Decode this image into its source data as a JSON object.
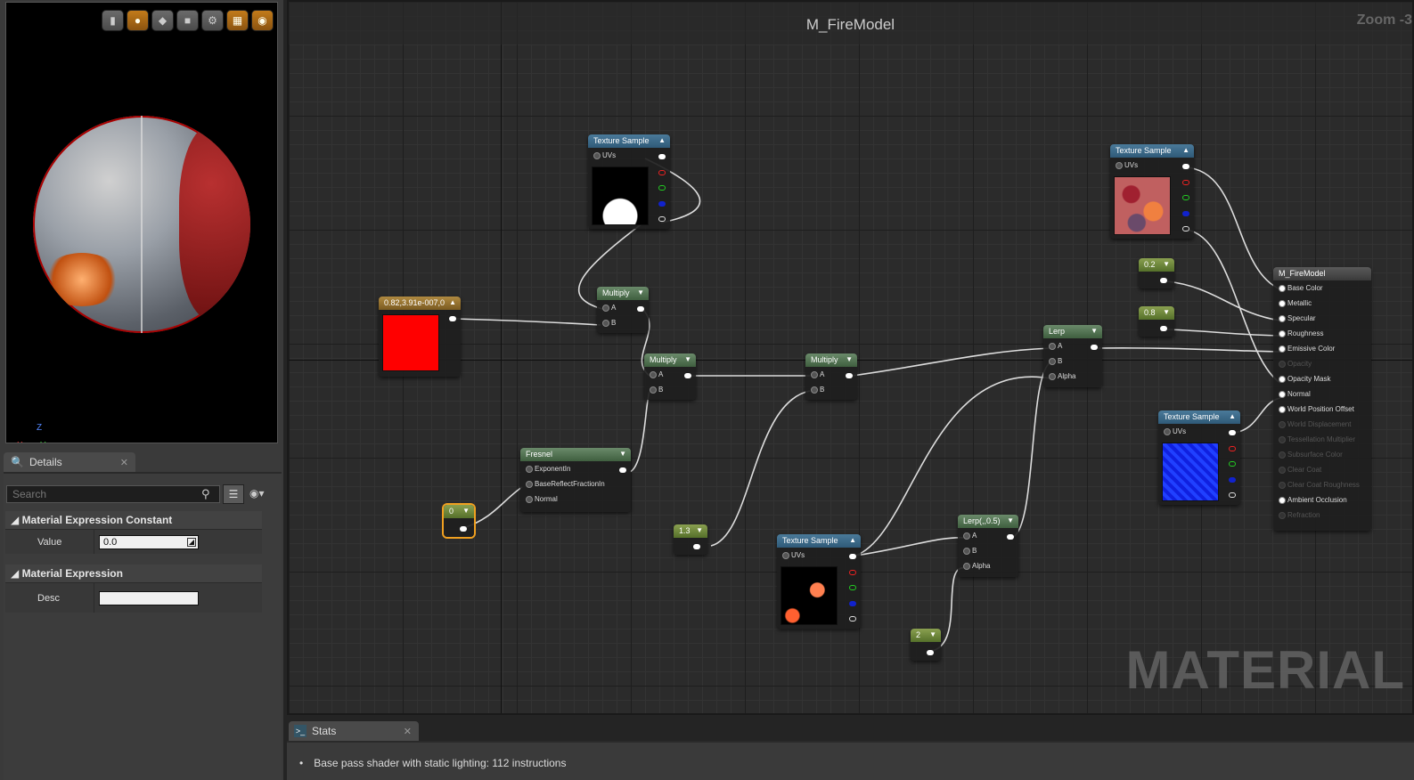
{
  "viewport": {
    "toolbar": [
      "cylinder-icon",
      "sphere-icon",
      "plane-icon",
      "cube-icon",
      "custom-mesh-icon",
      "grid-icon",
      "realtime-icon"
    ],
    "axes": {
      "x": "X",
      "y": "Y",
      "z": "Z"
    }
  },
  "details": {
    "tab_label": "Details",
    "search_placeholder": "Search",
    "categories": [
      {
        "title": "Material Expression Constant",
        "props": [
          {
            "name": "Value",
            "value": "0.0"
          }
        ]
      },
      {
        "title": "Material Expression",
        "props": [
          {
            "name": "Desc",
            "value": ""
          }
        ]
      }
    ]
  },
  "graph": {
    "title": "M_FireModel",
    "zoom": "Zoom -3",
    "watermark": "MATERIAL",
    "nodes": {
      "tex1": {
        "title": "Texture Sample",
        "uvs": "UVs"
      },
      "tex2": {
        "title": "Texture Sample",
        "uvs": "UVs"
      },
      "tex3": {
        "title": "Texture Sample",
        "uvs": "UVs"
      },
      "tex4": {
        "title": "Texture Sample",
        "uvs": "UVs"
      },
      "vec": {
        "title": "0.82,3.91e-007,0"
      },
      "mul1": {
        "title": "Multiply",
        "a": "A",
        "b": "B"
      },
      "mul2": {
        "title": "Multiply",
        "a": "A",
        "b": "B"
      },
      "mul3": {
        "title": "Multiply",
        "a": "A",
        "b": "B"
      },
      "fresnel": {
        "title": "Fresnel",
        "pins": [
          "ExponentIn",
          "BaseReflectFractionIn",
          "Normal"
        ]
      },
      "c0": {
        "title": "0"
      },
      "c13": {
        "title": "1.3"
      },
      "c2": {
        "title": "2"
      },
      "c02": {
        "title": "0.2"
      },
      "c08": {
        "title": "0.8"
      },
      "lerp1": {
        "title": "Lerp",
        "a": "A",
        "b": "B",
        "alpha": "Alpha"
      },
      "lerp2": {
        "title": "Lerp(,,0.5)",
        "a": "A",
        "b": "B",
        "alpha": "Alpha"
      },
      "result": {
        "title": "M_FireModel",
        "pins": [
          {
            "label": "Base Color",
            "active": true
          },
          {
            "label": "Metallic",
            "active": true
          },
          {
            "label": "Specular",
            "active": true
          },
          {
            "label": "Roughness",
            "active": true
          },
          {
            "label": "Emissive Color",
            "active": true
          },
          {
            "label": "Opacity",
            "active": false
          },
          {
            "label": "Opacity Mask",
            "active": true
          },
          {
            "label": "Normal",
            "active": true
          },
          {
            "label": "World Position Offset",
            "active": true
          },
          {
            "label": "World Displacement",
            "active": false
          },
          {
            "label": "Tessellation Multiplier",
            "active": false
          },
          {
            "label": "Subsurface Color",
            "active": false
          },
          {
            "label": "Clear Coat",
            "active": false
          },
          {
            "label": "Clear Coat Roughness",
            "active": false
          },
          {
            "label": "Ambient Occlusion",
            "active": true
          },
          {
            "label": "Refraction",
            "active": false
          }
        ]
      }
    }
  },
  "stats": {
    "tab_label": "Stats",
    "lines": [
      "Base pass shader with static lighting: 112 instructions"
    ]
  }
}
